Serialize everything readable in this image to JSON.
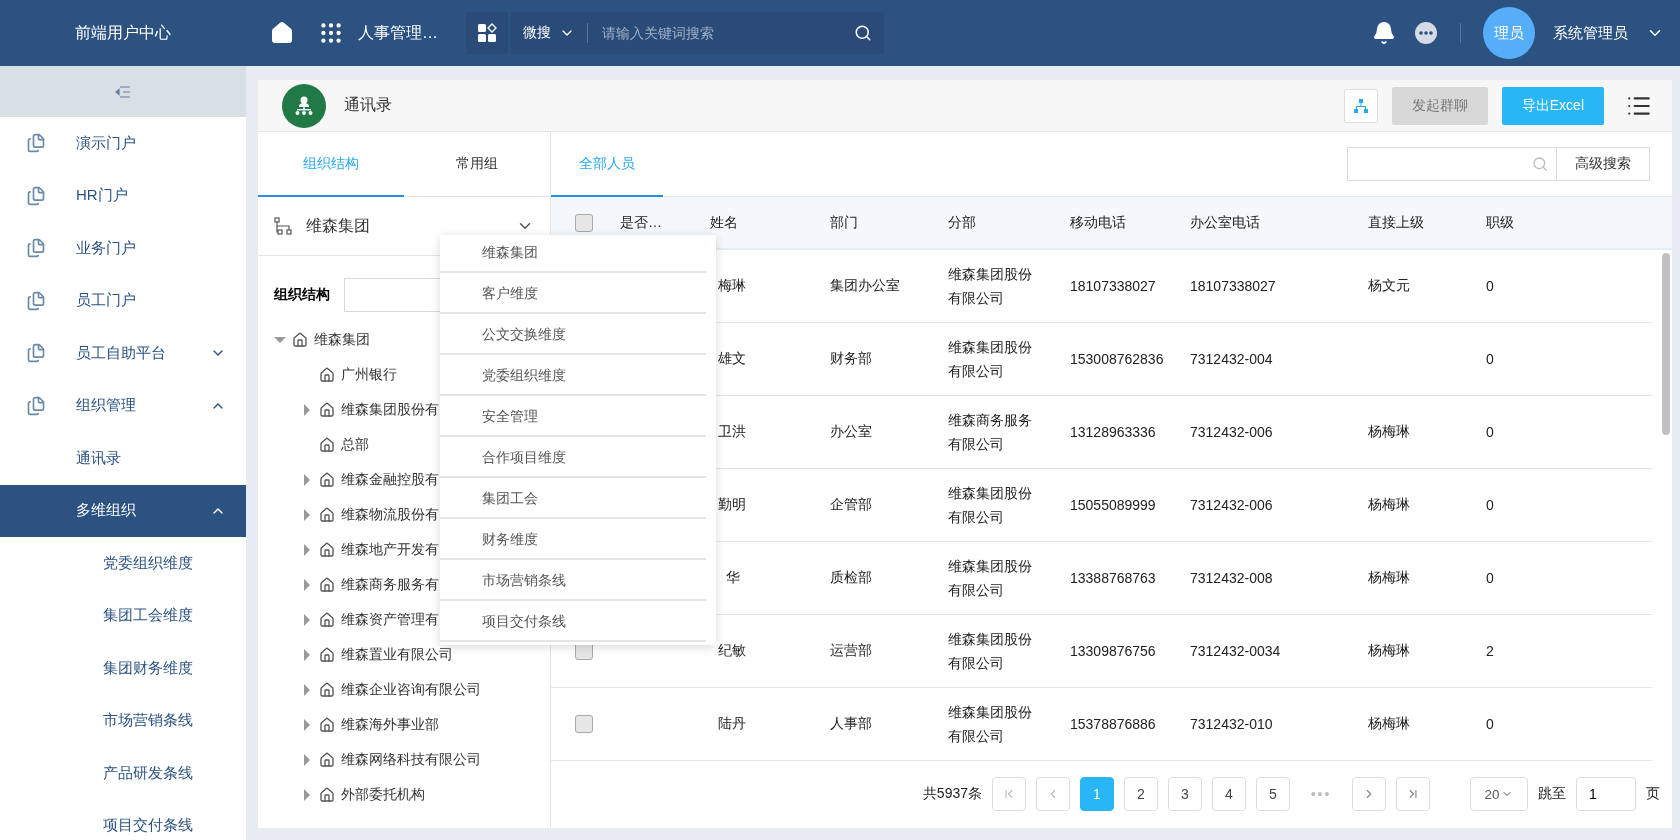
{
  "topbar": {
    "title": "前端用户中心",
    "app_name": "人事管理…",
    "search": {
      "scope": "微搜",
      "placeholder": "请输入关键词搜索"
    },
    "avatar": "理员",
    "user": "系统管理员"
  },
  "sidebar": {
    "items": [
      {
        "label": "演示门户",
        "selected": false
      },
      {
        "label": "HR门户",
        "selected": false
      },
      {
        "label": "业务门户",
        "selected": false
      },
      {
        "label": "员工门户",
        "selected": false
      },
      {
        "label": "员工自助平台",
        "selected": false,
        "expanded": false
      },
      {
        "label": "组织管理",
        "selected": false,
        "expanded": true,
        "children": [
          {
            "label": "通讯录",
            "selected": false
          },
          {
            "label": "多维组织",
            "selected": true,
            "expanded": true,
            "children": [
              {
                "label": "党委组织维度",
                "selected": false
              },
              {
                "label": "集团工会维度",
                "selected": false
              },
              {
                "label": "集团财务维度",
                "selected": false
              },
              {
                "label": "市场营销条线",
                "selected": false
              },
              {
                "label": "产品研发条线",
                "selected": false
              },
              {
                "label": "项目交付条线",
                "selected": false
              }
            ]
          }
        ]
      }
    ]
  },
  "page": {
    "title": "通讯录",
    "buttons": [
      {
        "label": "发起群聊",
        "disabled": true
      },
      {
        "label": "导出Excel",
        "disabled": false
      }
    ]
  },
  "left_panel": {
    "tabs": [
      {
        "label": "组织结构",
        "selected": true
      },
      {
        "label": "常用组",
        "selected": false
      }
    ],
    "dimension": "维森集团",
    "filter_label": "组织结构",
    "tree": [
      {
        "label": "维森集团",
        "kind": "branch",
        "expanded": true,
        "children": [
          {
            "label": "广州银行",
            "kind": "leaf"
          },
          {
            "label": "维森集团股份有",
            "kind": "branch",
            "expanded": false
          },
          {
            "label": "总部",
            "kind": "leaf"
          },
          {
            "label": "维森金融控股有",
            "kind": "branch",
            "expanded": false
          },
          {
            "label": "维森物流股份有",
            "kind": "branch",
            "expanded": false
          },
          {
            "label": "维森地产开发有",
            "kind": "branch",
            "expanded": false
          },
          {
            "label": "维森商务服务有",
            "kind": "branch",
            "expanded": false
          },
          {
            "label": "维森资产管理有",
            "kind": "branch",
            "expanded": false
          },
          {
            "label": "维森置业有限公司",
            "kind": "branch",
            "expanded": false
          },
          {
            "label": "维森企业咨询有限公司",
            "kind": "branch",
            "expanded": false
          },
          {
            "label": "维森海外事业部",
            "kind": "branch",
            "expanded": false
          },
          {
            "label": "维森网络科技有限公司",
            "kind": "branch",
            "expanded": false
          },
          {
            "label": "外部委托机构",
            "kind": "branch",
            "expanded": false
          }
        ]
      }
    ],
    "dropdown": [
      "维森集团",
      "客户维度",
      "公文交换维度",
      "党委组织维度",
      "安全管理",
      "合作项目维度",
      "集团工会",
      "财务维度",
      "市场营销条线",
      "项目交付条线"
    ]
  },
  "table_panel": {
    "tabs": [
      {
        "label": "全部人员",
        "selected": true
      }
    ],
    "advanced_search": "高级搜索",
    "select_all": {
      "checked": false
    },
    "columns": [
      "是否…",
      "姓名",
      "部门",
      "分部",
      "移动电话",
      "办公室电话",
      "直接上级",
      "职级"
    ],
    "rows": [
      {
        "name": "梅琳",
        "department": "集团办公室",
        "branch": "维森集团股份有限公司",
        "mobile": "18107338027",
        "office": "18107338027",
        "manager": "杨文元",
        "level": "0"
      },
      {
        "name": "雄文",
        "department": "财务部",
        "branch": "维森集团股份有限公司",
        "mobile": "153008762836",
        "office": "7312432-004",
        "level": "0"
      },
      {
        "name": "卫洪",
        "department": "办公室",
        "branch": "维森商务服务有限公司",
        "mobile": "13128963336",
        "office": "7312432-006",
        "manager": "杨梅琳",
        "level": "0"
      },
      {
        "name": "勤明",
        "department": "企管部",
        "branch": "维森集团股份有限公司",
        "mobile": "15055089999",
        "office": "7312432-006",
        "manager": "杨梅琳",
        "level": "0"
      },
      {
        "name": "华",
        "department": "质检部",
        "branch": "维森集团股份有限公司",
        "mobile": "13388768763",
        "office": "7312432-008",
        "manager": "杨梅琳",
        "level": "0"
      },
      {
        "checked": false,
        "name": "纪敏",
        "department": "运营部",
        "branch": "维森集团股份有限公司",
        "mobile": "13309876756",
        "office": "7312432-0034",
        "manager": "杨梅琳",
        "level": "2"
      },
      {
        "checked": false,
        "name": "陆丹",
        "department": "人事部",
        "branch": "维森集团股份有限公司",
        "mobile": "15378876886",
        "office": "7312432-010",
        "manager": "杨梅琳",
        "level": "0"
      }
    ],
    "pagination": {
      "total": "共5937条",
      "pages": [
        {
          "label": "1",
          "selected": true
        },
        {
          "label": "2",
          "selected": false
        },
        {
          "label": "3",
          "selected": false
        },
        {
          "label": "4",
          "selected": false
        },
        {
          "label": "5",
          "selected": false
        }
      ],
      "ellipsis": "•••",
      "page_size": "20",
      "jump_label": "跳至",
      "jump_value": "1",
      "page_unit": "页"
    }
  }
}
